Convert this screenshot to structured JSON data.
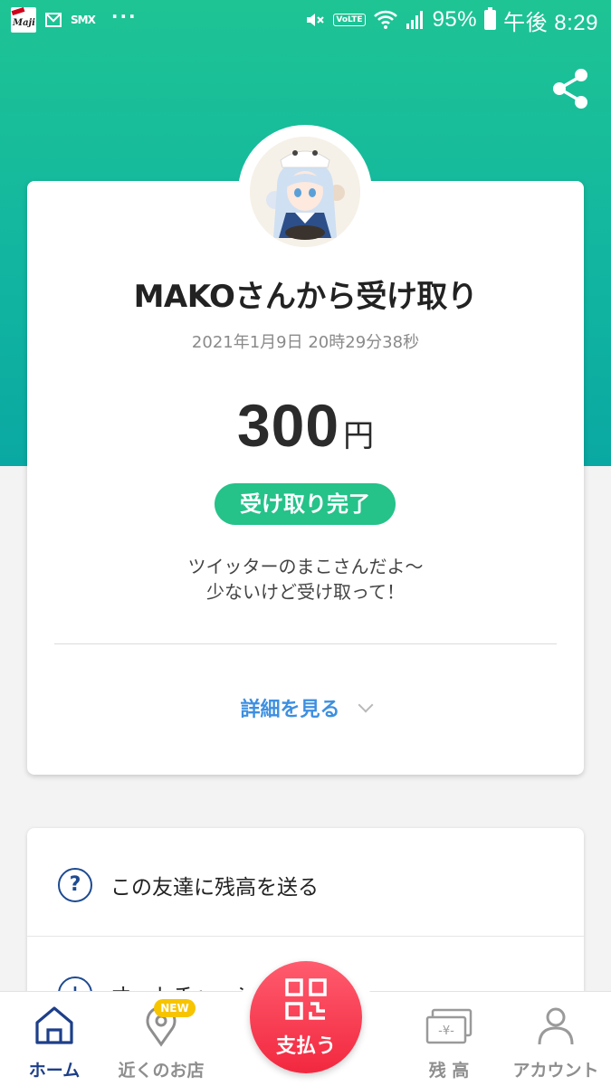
{
  "status_bar": {
    "battery": "95%",
    "time": "午後 8:29",
    "volte": "VoLTE",
    "app_badge": "Maji",
    "notif_text": "SMX",
    "more": "···",
    "icons": [
      "maji-app-icon",
      "mail-icon",
      "mute-icon",
      "wifi-icon",
      "signal-icon",
      "battery-icon"
    ]
  },
  "header": {
    "share_icon": "share-icon",
    "accent_color": "#1ec494"
  },
  "receipt": {
    "title": "MAKOさんから受け取り",
    "datetime": "2021年1月9日 20時29分38秒",
    "amount": "300",
    "currency": "円",
    "status": "受け取り完了",
    "status_color": "#25c28a",
    "message_lines": [
      "ツイッターのまこさんだよ～",
      "少ないけど受け取って！"
    ],
    "details_label": "詳細を見る"
  },
  "actions": [
    {
      "label": "この友達に残高を送る",
      "icon": "?"
    },
    {
      "label": "オートチャージ設定",
      "icon": "+"
    }
  ],
  "nav": {
    "home": "ホーム",
    "nearby": "近くのお店",
    "new_badge": "NEW",
    "pay": "支払う",
    "balance": "残 高",
    "account": "アカウント",
    "active_color": "#1d3f8a",
    "pay_color": "#f2283f"
  }
}
